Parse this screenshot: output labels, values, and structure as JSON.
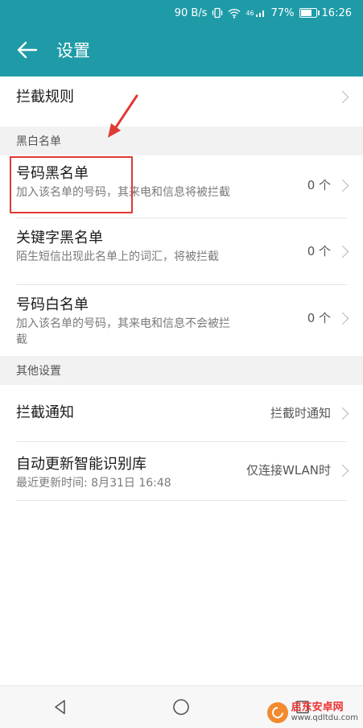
{
  "status_bar": {
    "speed": "90 B/s",
    "network": "46",
    "battery": "77%",
    "time": "16:26"
  },
  "header": {
    "title": "设置"
  },
  "rows": {
    "intercept_rules": {
      "label": "拦截规则"
    },
    "section_blackwhite": "黑白名单",
    "number_blacklist": {
      "label": "号码黑名单",
      "sub": "加入该名单的号码，其来电和信息将被拦截",
      "value": "0 个"
    },
    "keyword_blacklist": {
      "label": "关键字黑名单",
      "sub": "陌生短信出现此名单上的词汇，将被拦截",
      "value": "0 个"
    },
    "number_whitelist": {
      "label": "号码白名单",
      "sub": "加入该名单的号码，其来电和信息不会被拦截",
      "value": "0 个"
    },
    "section_other": "其他设置",
    "intercept_notify": {
      "label": "拦截通知",
      "value": "拦截时通知"
    },
    "auto_update": {
      "label": "自动更新智能识别库",
      "sub": "最近更新时间: 8月31日 16:48",
      "value": "仅连接WLAN时"
    }
  },
  "watermark": {
    "name": "启东安卓网",
    "url": "www.qdltdu.com"
  },
  "colors": {
    "header": "#1f9ba8",
    "highlight": "#e03a33"
  }
}
